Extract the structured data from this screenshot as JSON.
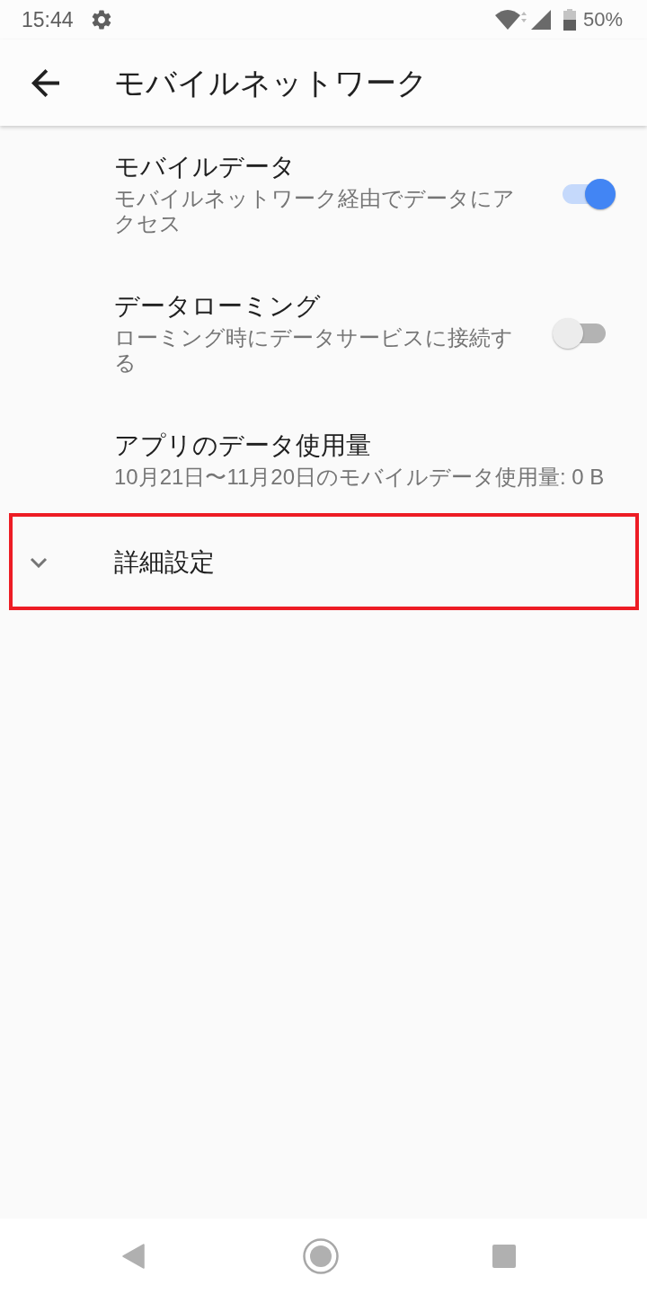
{
  "status_bar": {
    "time": "15:44",
    "battery": "50%"
  },
  "app_bar": {
    "title": "モバイルネットワーク"
  },
  "settings": [
    {
      "kind": "switch",
      "title": "モバイルデータ",
      "summary": "モバイルネットワーク経由でデータにアクセス",
      "on": true,
      "highlighted": false
    },
    {
      "kind": "switch",
      "title": "データローミング",
      "summary": "ローミング時にデータサービスに接続する",
      "on": false,
      "highlighted": false
    },
    {
      "kind": "plain",
      "title": "アプリのデータ使用量",
      "summary": "10月21日〜11月20日のモバイルデータ使用量: 0 B",
      "highlighted": false
    },
    {
      "kind": "expander",
      "title": "詳細設定",
      "expanded": false,
      "highlighted": true
    }
  ]
}
